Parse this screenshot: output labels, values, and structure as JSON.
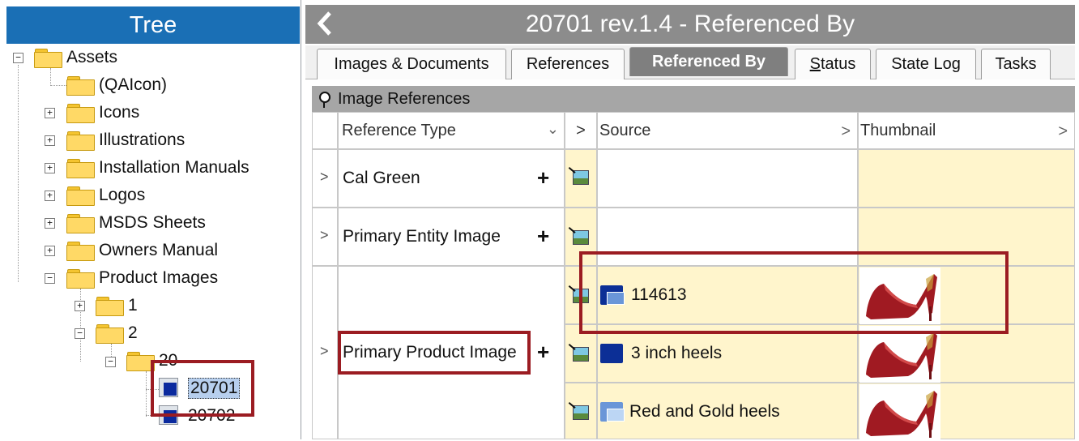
{
  "tree": {
    "header": "Tree",
    "nodes": {
      "assets": "Assets",
      "qaicon": "(QAIcon)",
      "icons": "Icons",
      "illustrations": "Illustrations",
      "installation_manuals": "Installation Manuals",
      "logos": "Logos",
      "msds_sheets": "MSDS Sheets",
      "owners_manual": "Owners Manual",
      "product_images": "Product Images",
      "folder_1": "1",
      "folder_2": "2",
      "folder_20": "20",
      "item_20701": "20701",
      "item_20702": "20702"
    },
    "expanders": {
      "minus": "−",
      "plus": "+"
    }
  },
  "window": {
    "title": "20701 rev.1.4 - Referenced By"
  },
  "tabs": [
    {
      "label": "Images & Documents"
    },
    {
      "label": "References"
    },
    {
      "label": "Referenced By",
      "active": true
    },
    {
      "label_underlined": "S",
      "label_rest": "tatus"
    },
    {
      "label": "State Log"
    },
    {
      "label": "Tasks"
    }
  ],
  "section": {
    "title": "Image References"
  },
  "grid": {
    "columns": {
      "reference_type": "Reference Type",
      "source": "Source",
      "thumbnail": "Thumbnail"
    },
    "rows": [
      {
        "reference_type": "Cal Green"
      },
      {
        "reference_type": "Primary Entity Image"
      },
      {
        "reference_type": "Primary Product Image"
      }
    ],
    "sources": [
      {
        "name": "114613"
      },
      {
        "name": "3 inch heels"
      },
      {
        "name": "Red and Gold heels"
      }
    ],
    "glyphs": {
      "chevron": ">",
      "plus": "+",
      "sort_down": "⌄"
    }
  },
  "colors": {
    "tree_header": "#1a6fb5",
    "title_bar": "#8c8c8c",
    "active_tab": "#7f7f7f",
    "row_highlight": "#fff5cc",
    "annotation_box": "#9b1c22",
    "shoe_red": "#a01a22"
  }
}
